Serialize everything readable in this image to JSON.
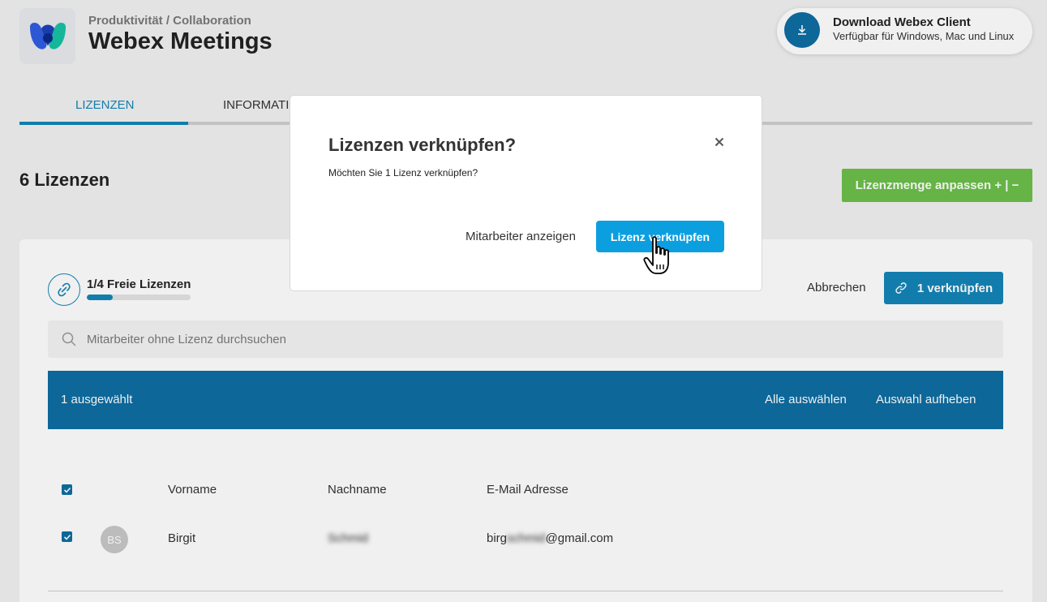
{
  "header": {
    "breadcrumb": "Produktivität / Collaboration",
    "title": "Webex Meetings",
    "logo_icon": "webex-logo-icon",
    "download": {
      "icon": "download-icon",
      "title": "Download Webex Client",
      "subtitle": "Verfügbar für Windows, Mac und Linux"
    }
  },
  "tabs": [
    {
      "label": "LIZENZEN",
      "active": true
    },
    {
      "label": "INFORMATIC",
      "active": false
    }
  ],
  "licenses": {
    "heading": "6 Lizenzen",
    "adjust_button": "Lizenzmenge anpassen + | −"
  },
  "panel": {
    "free_icon": "unlink-icon",
    "free_label": "1/4 Freie Lizenzen",
    "free_ratio": 0.25,
    "cancel_label": "Abbrechen",
    "link_button": "1 verknüpfen",
    "link_icon": "link-icon",
    "search_placeholder": "Mitarbeiter ohne Lizenz durchsuchen",
    "selection": {
      "count": "1 ausgewählt",
      "select_all": "Alle auswählen",
      "deselect": "Auswahl aufheben"
    },
    "columns": [
      "Vorname",
      "Nachname",
      "E-Mail Adresse"
    ],
    "rows": [
      {
        "initials": "BS",
        "first": "Birgit",
        "last": "Schmid",
        "email_prefix": "birg",
        "email_hidden": "schmid",
        "email_suffix": "@gmail.com",
        "checked": true
      }
    ]
  },
  "modal": {
    "title": "Lizenzen verknüpfen?",
    "text": "Möchten Sie 1 Lizenz verknüpfen?",
    "secondary": "Mitarbeiter anzeigen",
    "primary": "Lizenz verknüpfen",
    "close_icon": "close-icon"
  },
  "colors": {
    "accent": "#1485b8",
    "selection_bar": "#0e6ea3",
    "primary_button": "#0c9fe0",
    "adjust_button": "#6cc04a"
  }
}
